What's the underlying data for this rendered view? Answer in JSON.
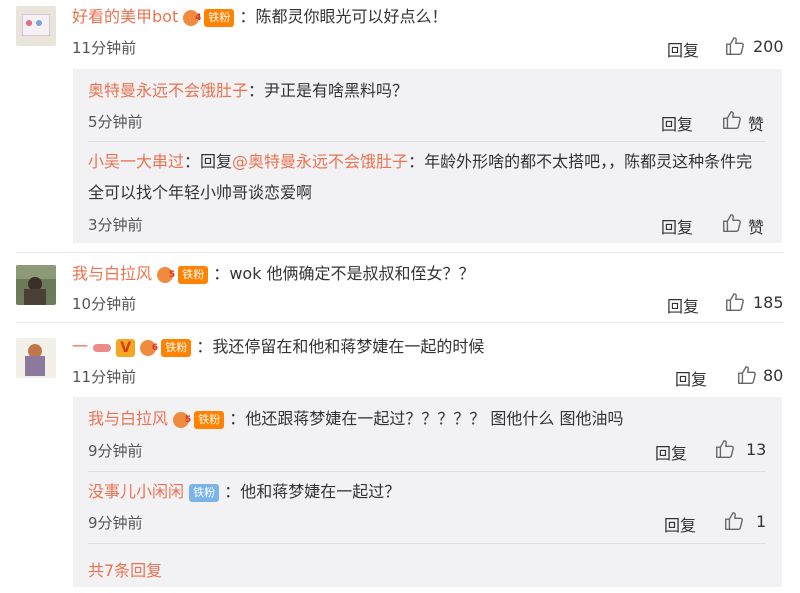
{
  "comments": [
    {
      "username": "好看的美甲bot",
      "badge": "铁粉",
      "text": "陈都灵你眼光可以好点么！",
      "time": "11分钟前",
      "reply": "回复",
      "likes": "200",
      "replies": [
        {
          "username": "奥特曼永远不会饿肚子",
          "text": "尹正是有啥黑料吗？",
          "time": "5分钟前",
          "reply": "回复",
          "likes": "赞"
        },
        {
          "username": "小吴一大串过",
          "prefix": "回复",
          "mention": "@奥特曼永远不会饿肚子",
          "text_line1": "年龄外形啥的都不太搭吧，，陈都灵这种条件完",
          "text_line2": "全可以找个年轻小帅哥谈恋爱啊",
          "time": "3分钟前",
          "reply": "回复",
          "likes": "赞"
        }
      ]
    },
    {
      "username": "我与白拉风",
      "badge": "铁粉",
      "text": "wok 他俩确定不是叔叔和侄女？？",
      "time": "10分钟前",
      "reply": "回复",
      "likes": "185"
    },
    {
      "username": "一",
      "verified": "V",
      "badge": "铁粉",
      "text": "我还停留在和他和蒋梦婕在一起的时候",
      "time": "11分钟前",
      "reply": "回复",
      "likes": "80",
      "replies": [
        {
          "username": "我与白拉风",
          "badge": "铁粉",
          "text": "他还跟蒋梦婕在一起过？？？？？ 图他什么 图他油吗",
          "time": "9分钟前",
          "reply": "回复",
          "likes": "13"
        },
        {
          "username": "没事儿小闲闲",
          "badge": "铁粉",
          "text": "他和蒋梦婕在一起过？",
          "time": "9分钟前",
          "reply": "回复",
          "likes": "1"
        }
      ],
      "more": "共7条回复"
    }
  ],
  "colors": {
    "name": "#eb7350",
    "badge": "#ff8200",
    "badge_blue": "#7ab3e8",
    "sub_bg": "#f2f2f5"
  }
}
